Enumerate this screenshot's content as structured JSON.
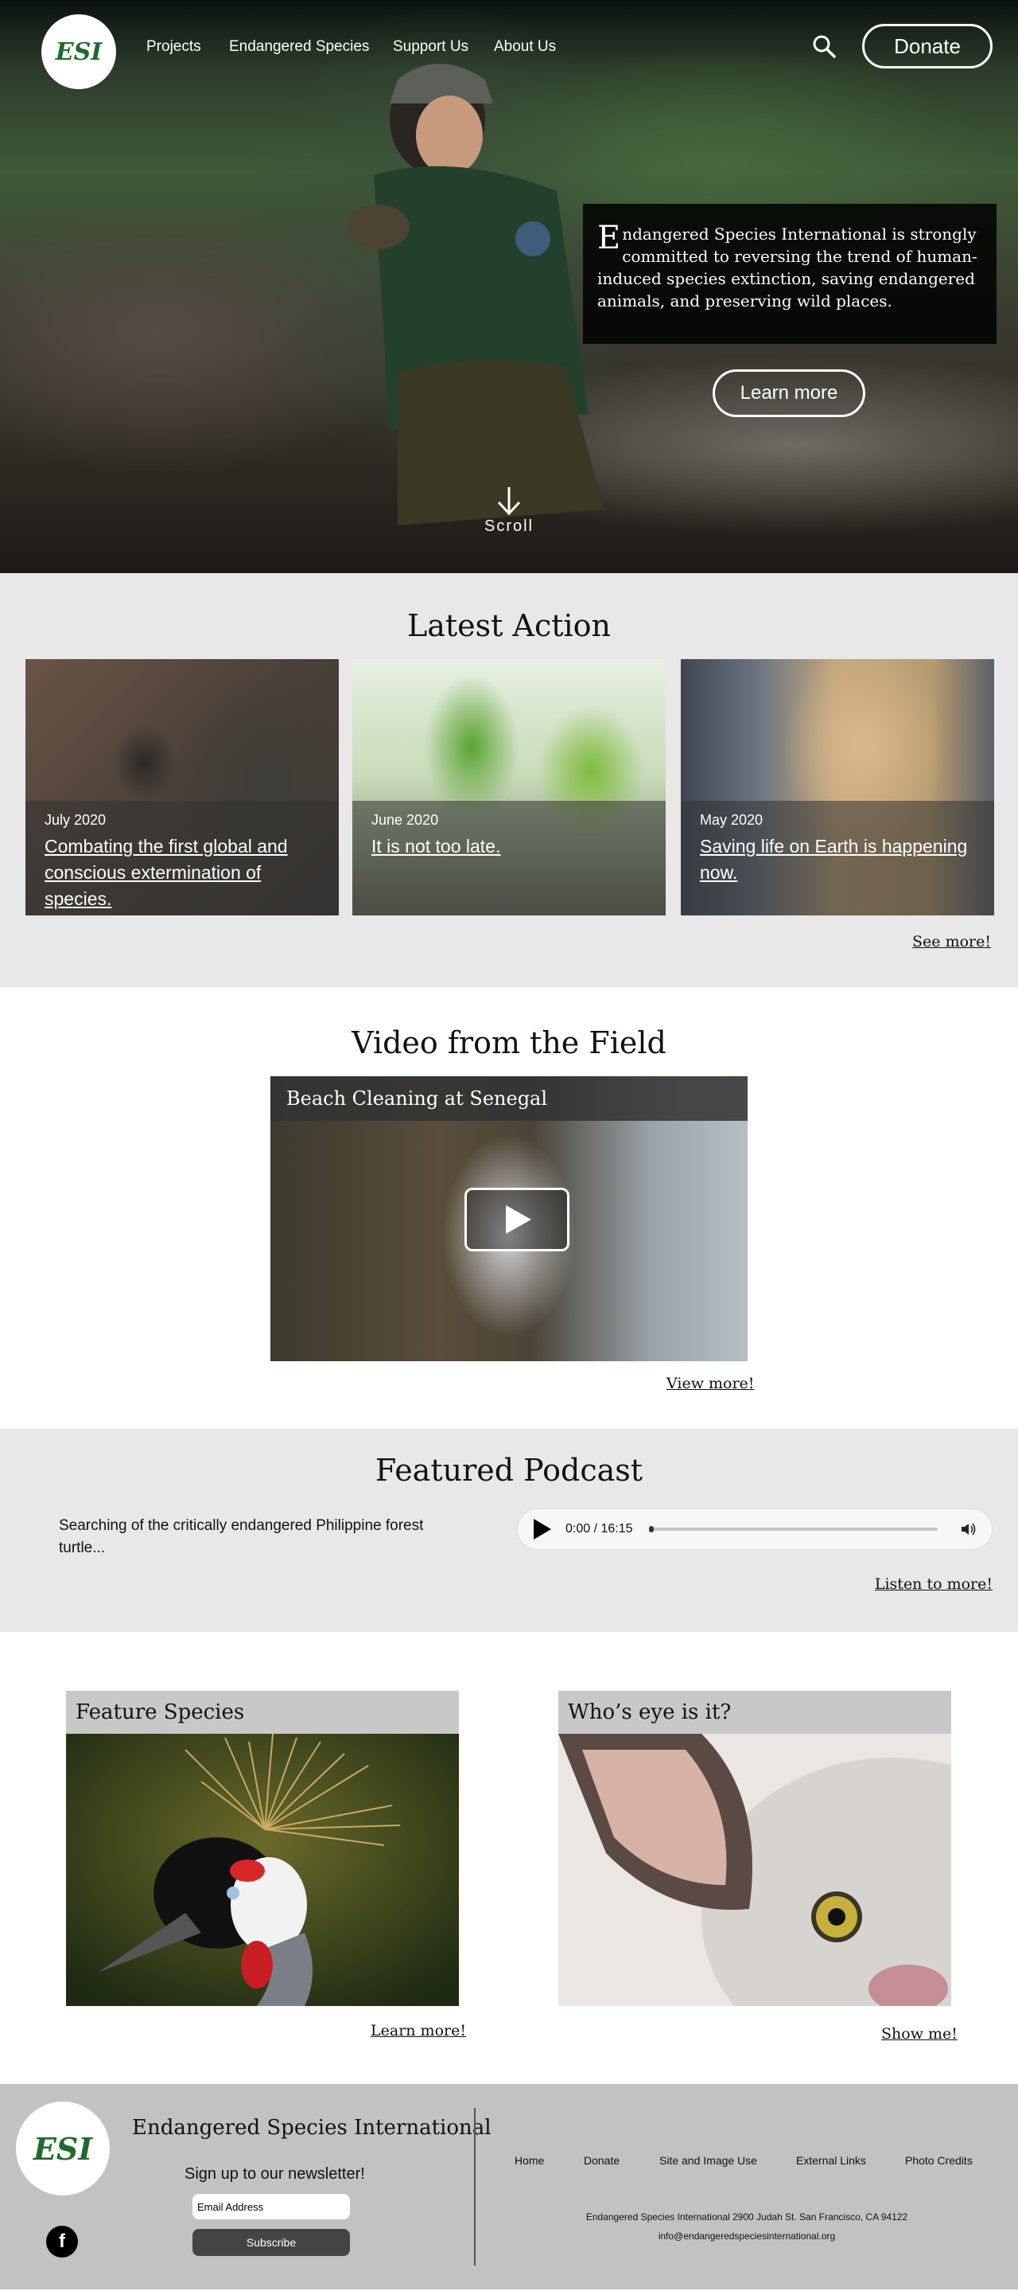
{
  "nav": {
    "logo_text": "ESI",
    "items": [
      "Projects",
      "Endangered Species",
      "Support Us",
      "About Us"
    ],
    "donate_label": "Donate"
  },
  "hero": {
    "mission_drop": "E",
    "mission_text": "ndangered Species International is strongly committed to reversing the trend of human-induced species extinction, saving endangered animals, and preserving wild places.",
    "learn_label": "Learn more",
    "scroll_label": "Scroll"
  },
  "latest": {
    "title": "Latest Action",
    "cards": [
      {
        "date": "July 2020",
        "headline": "Combating the first global and conscious extermination of species."
      },
      {
        "date": "June 2020",
        "headline": "It is not too late."
      },
      {
        "date": "May 2020",
        "headline": "Saving life on Earth is happening now."
      }
    ],
    "see_more": "See more!"
  },
  "video": {
    "title": "Video from the Field",
    "clip_title": "Beach Cleaning at  Senegal",
    "view_more": "View more!"
  },
  "podcast": {
    "title": "Featured Podcast",
    "description": "Searching of the critically endangered Philippine forest turtle...",
    "time": "0:00 / 16:15",
    "progress": 0,
    "listen_more": "Listen to more!"
  },
  "features": {
    "species_title": "Feature Species",
    "species_link": "Learn more!",
    "eye_title": "Who’s eye is it?",
    "eye_link": "Show me!"
  },
  "footer": {
    "logo_text": "ESI",
    "org_name": "Endangered Species International",
    "newsletter_label": "Sign up to our newsletter!",
    "email_placeholder": "Email Address",
    "subscribe_label": "Subscribe",
    "facebook_glyph": "f",
    "links": [
      "Home",
      "Donate",
      "Site and Image Use",
      "External Links",
      "Photo Credits"
    ],
    "address": "Endangered Species International 2900 Judah St. San Francisco, CA 94122",
    "email": "info@endangeredspeciesinternational.org"
  }
}
